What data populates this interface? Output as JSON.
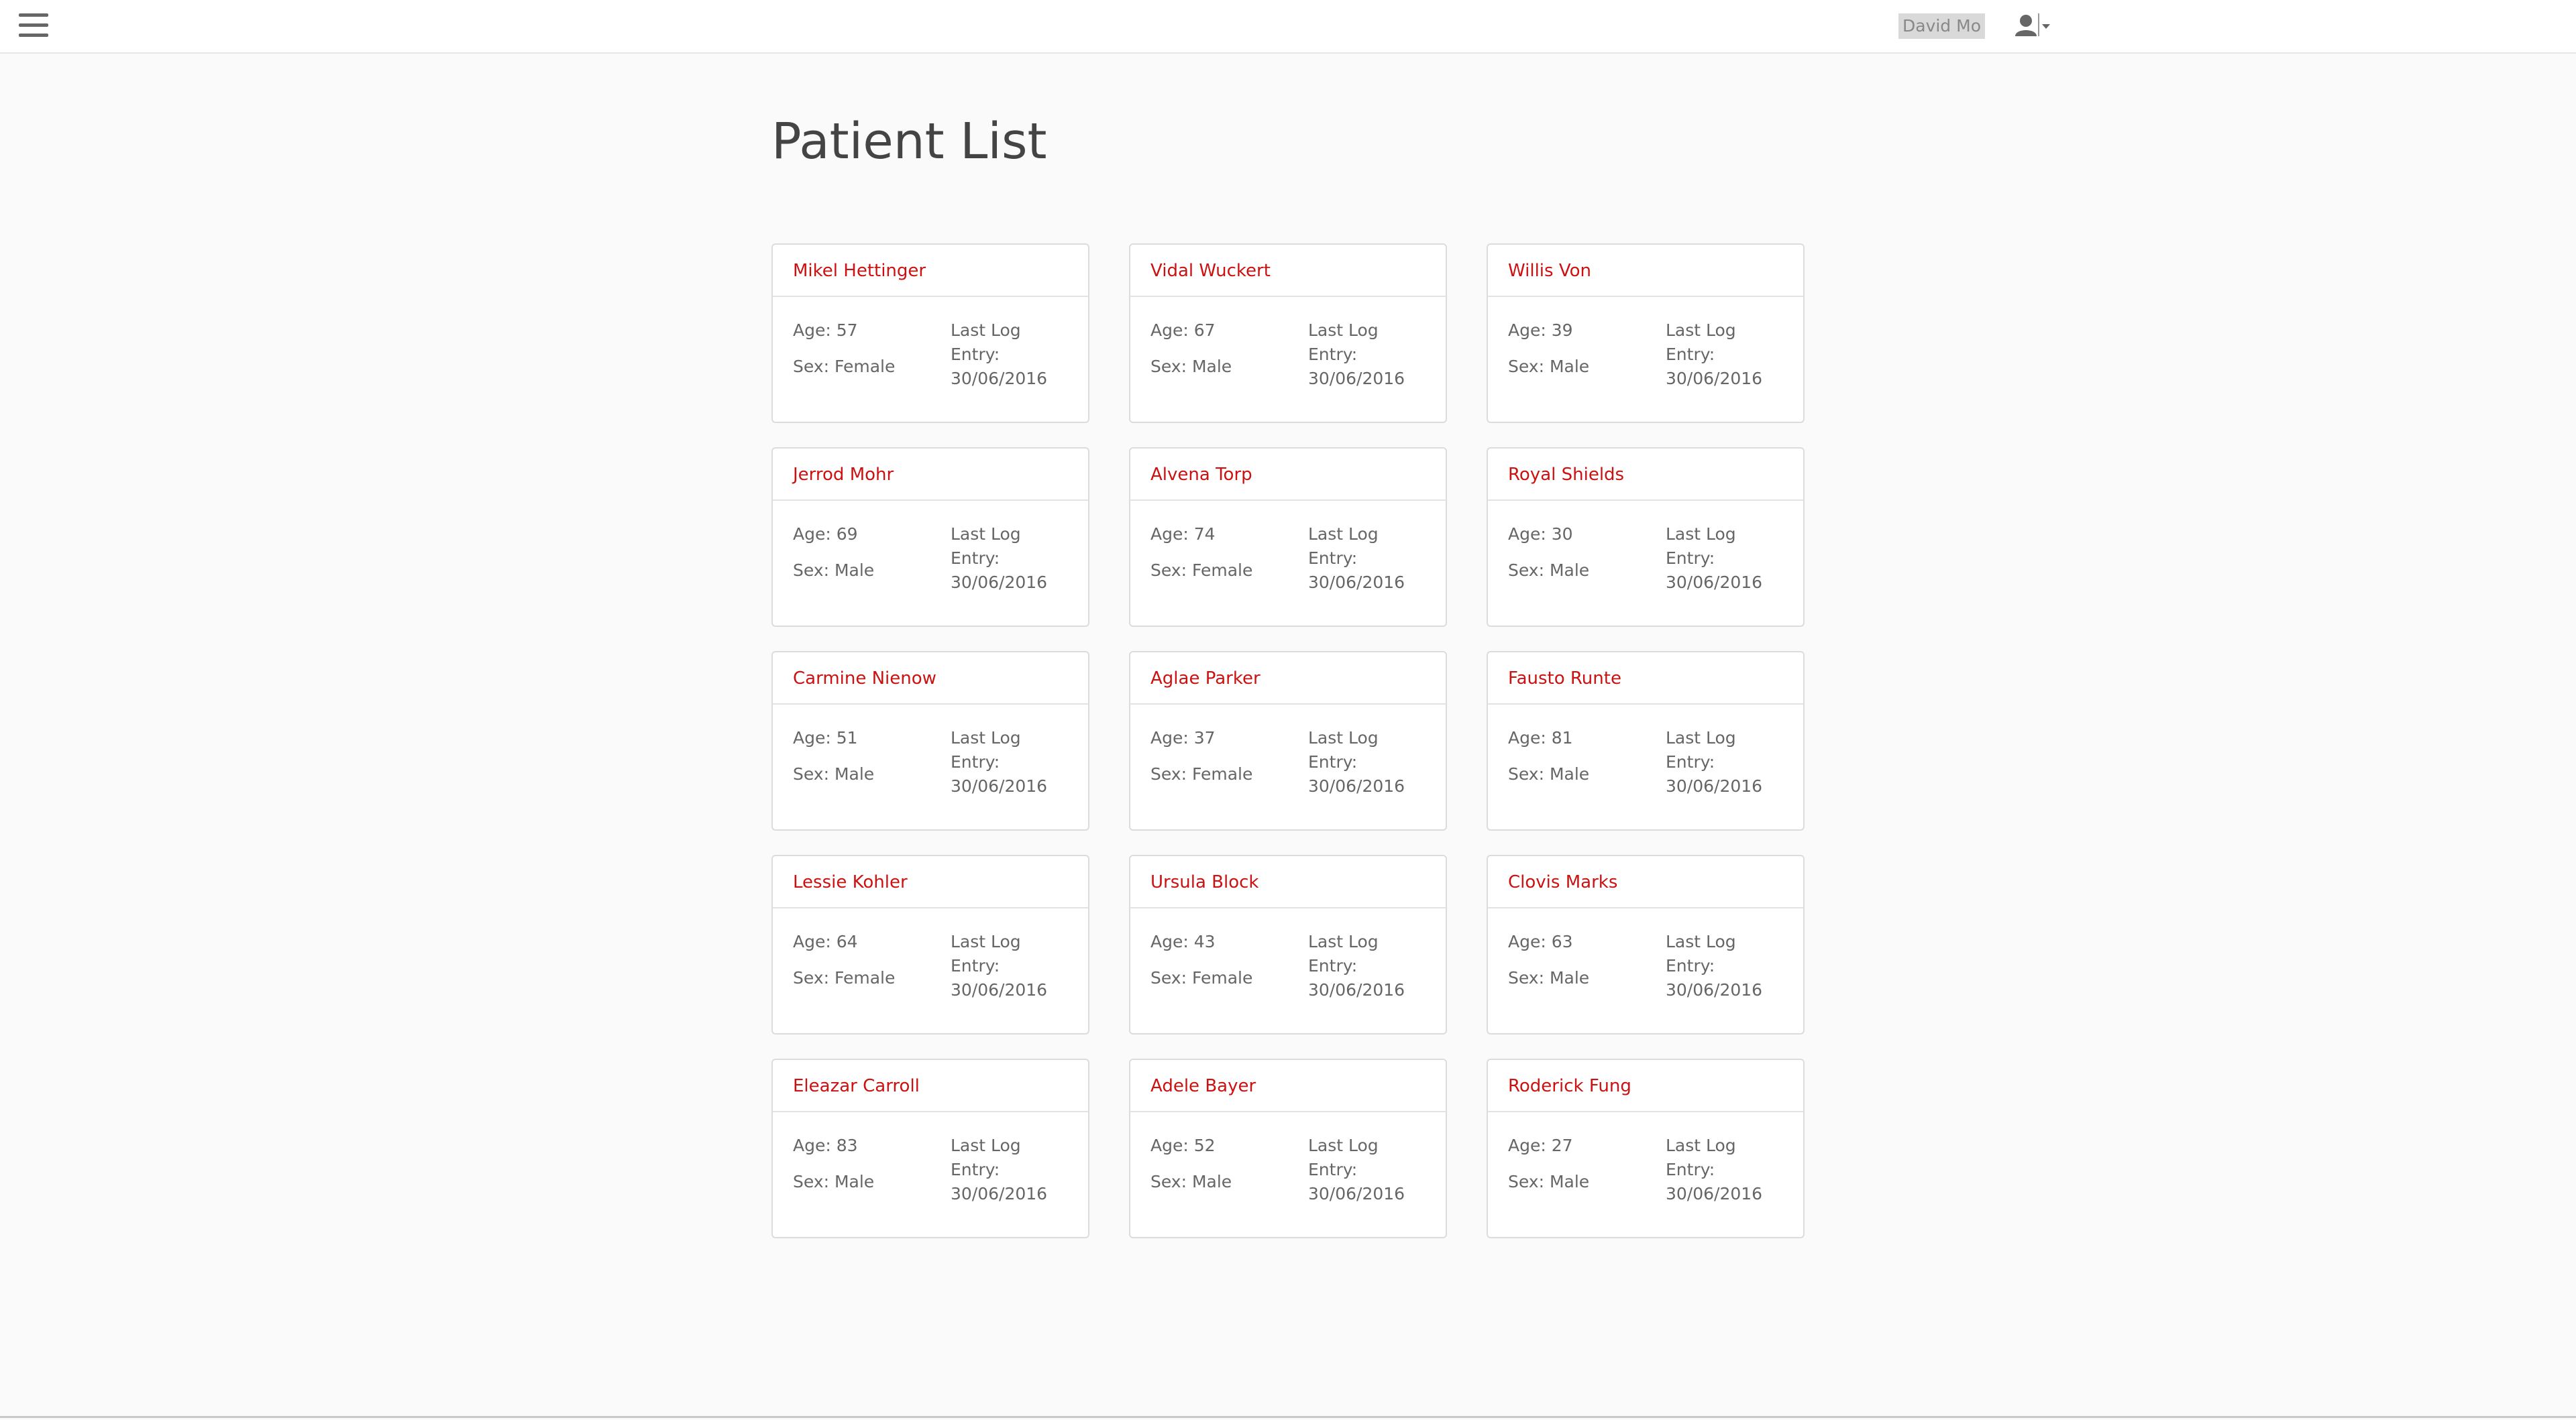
{
  "header": {
    "username": "David Mo",
    "menu_icon": "hamburger-menu-icon",
    "user_icon": "user-icon",
    "caret_icon": "caret-down-icon"
  },
  "page": {
    "title": "Patient List"
  },
  "labels": {
    "age_prefix": "Age: ",
    "sex_prefix": "Sex: ",
    "last_log_prefix": "Last Log Entry: "
  },
  "colors": {
    "accent": "#cc1111",
    "text": "#555555",
    "background": "#fafafa"
  },
  "patients": [
    {
      "name": "Mikel Hettinger",
      "age": "57",
      "sex": "Female",
      "last_log": "30/06/2016"
    },
    {
      "name": "Vidal Wuckert",
      "age": "67",
      "sex": "Male",
      "last_log": "30/06/2016"
    },
    {
      "name": "Willis Von",
      "age": "39",
      "sex": "Male",
      "last_log": "30/06/2016"
    },
    {
      "name": "Jerrod Mohr",
      "age": "69",
      "sex": "Male",
      "last_log": "30/06/2016"
    },
    {
      "name": "Alvena Torp",
      "age": "74",
      "sex": "Female",
      "last_log": "30/06/2016"
    },
    {
      "name": "Royal Shields",
      "age": "30",
      "sex": "Male",
      "last_log": "30/06/2016"
    },
    {
      "name": "Carmine Nienow",
      "age": "51",
      "sex": "Male",
      "last_log": "30/06/2016"
    },
    {
      "name": "Aglae Parker",
      "age": "37",
      "sex": "Female",
      "last_log": "30/06/2016"
    },
    {
      "name": "Fausto Runte",
      "age": "81",
      "sex": "Male",
      "last_log": "30/06/2016"
    },
    {
      "name": "Lessie Kohler",
      "age": "64",
      "sex": "Female",
      "last_log": "30/06/2016"
    },
    {
      "name": "Ursula Block",
      "age": "43",
      "sex": "Female",
      "last_log": "30/06/2016"
    },
    {
      "name": "Clovis Marks",
      "age": "63",
      "sex": "Male",
      "last_log": "30/06/2016"
    },
    {
      "name": "Eleazar Carroll",
      "age": "83",
      "sex": "Male",
      "last_log": "30/06/2016"
    },
    {
      "name": "Adele Bayer",
      "age": "52",
      "sex": "Male",
      "last_log": "30/06/2016"
    },
    {
      "name": "Roderick Fung",
      "age": "27",
      "sex": "Male",
      "last_log": "30/06/2016"
    }
  ]
}
